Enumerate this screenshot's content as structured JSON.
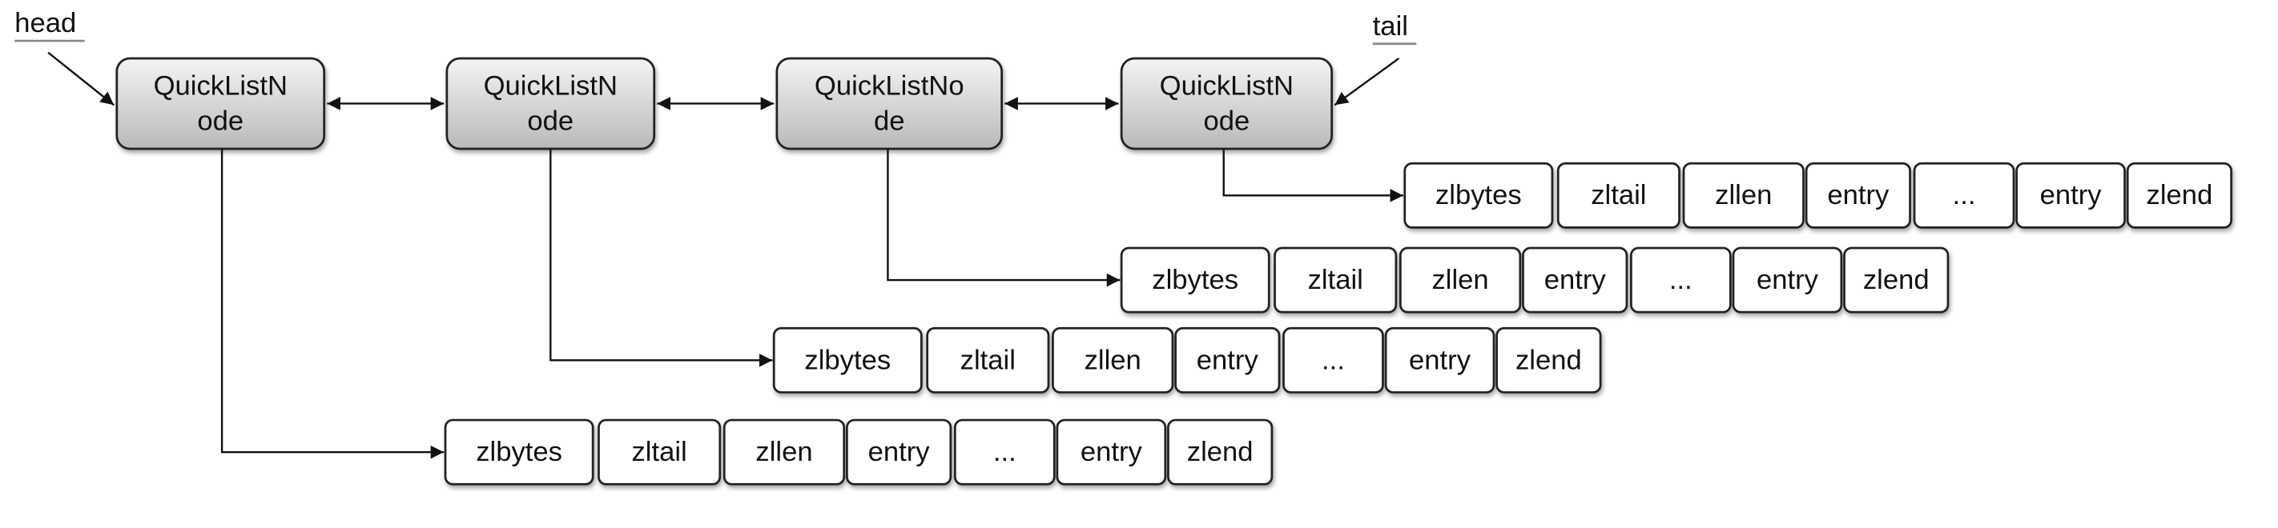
{
  "labels": {
    "head": "head",
    "tail": "tail"
  },
  "nodes": [
    {
      "lines": [
        "QuickListN",
        "ode"
      ]
    },
    {
      "lines": [
        "QuickListN",
        "ode"
      ]
    },
    {
      "lines": [
        "QuickListNo",
        "de"
      ]
    },
    {
      "lines": [
        "QuickListN",
        "ode"
      ]
    }
  ],
  "ziplist_cells": [
    "zlbytes",
    "zltail",
    "zllen",
    "entry",
    "...",
    "entry",
    "zlend"
  ],
  "colors": {
    "node_top": "#f4f4f4",
    "node_bottom": "#b9b9b9",
    "stroke": "#222222",
    "label": "#555555"
  }
}
